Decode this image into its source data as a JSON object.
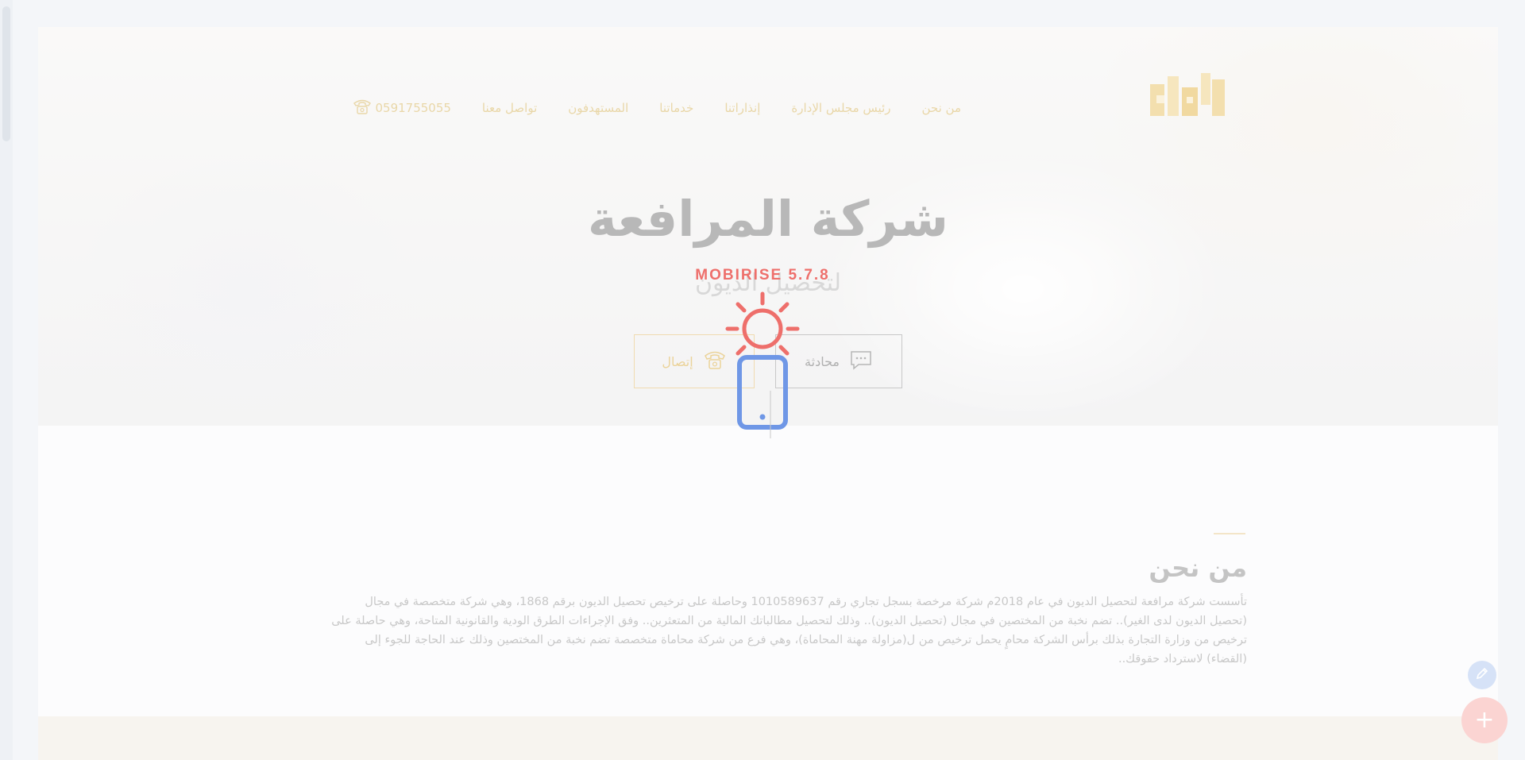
{
  "nav": {
    "items": [
      "من نحن",
      "رئيس مجلس الإدارة",
      "إنذاراتنا",
      "خدماتنا",
      "المستهدفون",
      "تواصل معنا"
    ],
    "phone": "0591755055"
  },
  "hero": {
    "title": "شركة المرافعة",
    "subtitle": "لتحصيل الديون",
    "chat_button": "محادثة",
    "call_button": "إتصال"
  },
  "about": {
    "title": "من نحن",
    "body": "تأسست شركة مرافعة لتحصيل الديون في عام 2018م شركة مرخصة بسجل تجاري رقم 1010589637 وحاصلة على ترخيص تحصيل الديون برقم 1868، وهي شركة متخصصة في مجال (تحصيل الديون لدى الغير).. تضم نخبة من المختصين في مجال (تحصيل الديون).. وذلك لتحصيل مطالباتك المالية من المتعثرين.. وفق الإجراءات الطرق الودية والقانونية المتاحة، وهي حاصلة على ترخيص من وزارة التجارة بذلك برأس الشركة محامٍ يحمل ترخيص من ل(مزاولة مهنة المحاماة)، وهي فرع من شركة محاماة متخصصة تضم نخبة من المختصين وذلك عند الحاجة للجوء إلى (القضاء) لاسترداد حقوقك.."
  },
  "loader": {
    "brand": "MOBIRISE 5.7.8"
  },
  "colors": {
    "accent_gold": "#e9d7a8",
    "loader_red": "#ee6f6b",
    "loader_blue": "#6f97e6"
  },
  "icons": [
    "logo-icon",
    "phone-icon",
    "chat-icon",
    "call-icon",
    "sun-icon",
    "mobile-icon",
    "pencil-icon",
    "plus-icon"
  ]
}
